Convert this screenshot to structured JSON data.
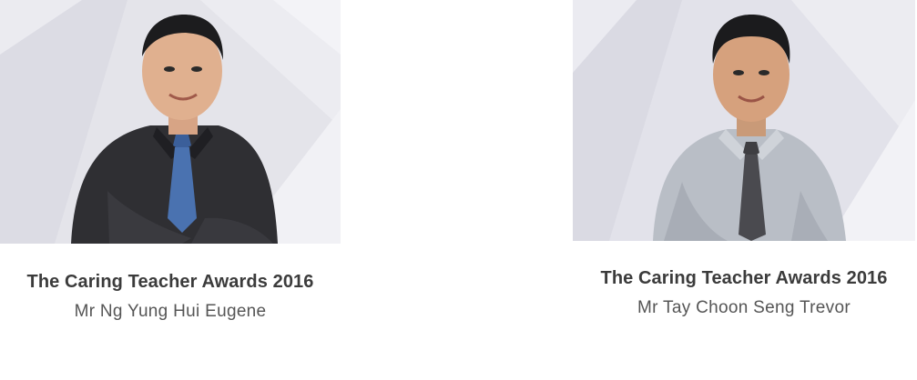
{
  "cards": [
    {
      "award": "The Caring Teacher Awards 2016",
      "name": "Mr Ng Yung Hui Eugene",
      "photo_icon": "teacher-portrait-photo"
    },
    {
      "award": "The Caring Teacher Awards 2016",
      "name": "Mr Tay Choon Seng Trevor",
      "photo_icon": "teacher-portrait-photo"
    }
  ],
  "colors": {
    "background": "#ffffff",
    "photo_bg": "#e3e3ea",
    "title": "#3b3b3b",
    "name": "#555555"
  }
}
